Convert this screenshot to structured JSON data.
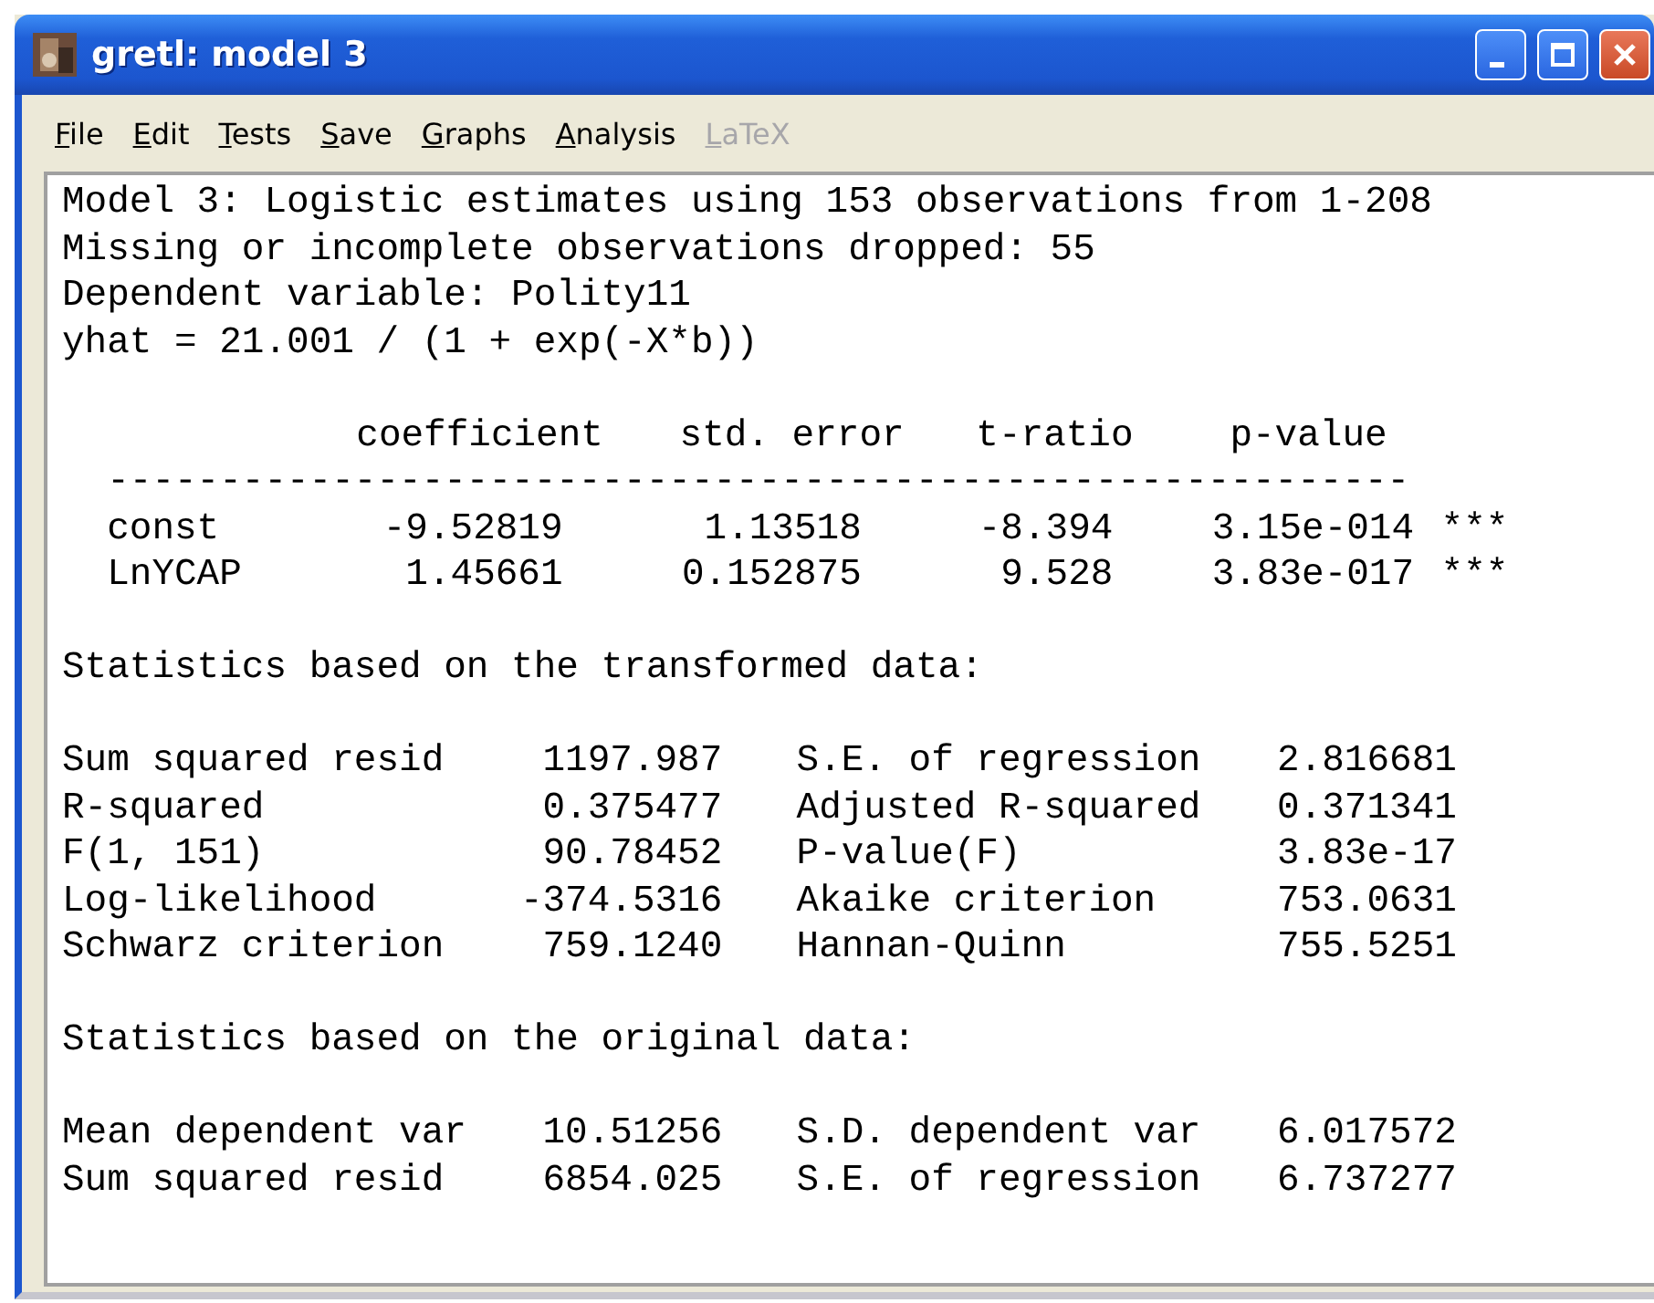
{
  "window": {
    "title": "gretl: model 3"
  },
  "menu": [
    {
      "label": "File",
      "disabled": false
    },
    {
      "label": "Edit",
      "disabled": false
    },
    {
      "label": "Tests",
      "disabled": false
    },
    {
      "label": "Save",
      "disabled": false
    },
    {
      "label": "Graphs",
      "disabled": false
    },
    {
      "label": "Analysis",
      "disabled": false
    },
    {
      "label": "LaTeX",
      "disabled": true
    }
  ],
  "output": {
    "header": [
      "Model 3: Logistic estimates using 153 observations from 1-208",
      "Missing or incomplete observations dropped: 55",
      "Dependent variable: Polity11",
      "yhat = 21.001 / (1 + exp(-X*b))"
    ],
    "table": {
      "columns": [
        "coefficient",
        "std. error",
        "t-ratio",
        "p-value"
      ],
      "separator": "----------------------------------------------------------",
      "rows": [
        {
          "name": "const",
          "coefficient": "-9.52819",
          "std_error": "1.13518",
          "t_ratio": "-8.394",
          "p_value": "3.15e-014",
          "stars": "***"
        },
        {
          "name": "LnYCAP",
          "coefficient": "1.45661",
          "std_error": "0.152875",
          "t_ratio": "9.528",
          "p_value": "3.83e-017",
          "stars": "***"
        }
      ]
    },
    "sections": [
      {
        "title": "Statistics based on the transformed data:",
        "rows": [
          {
            "label": "Sum squared resid",
            "value": "1197.987",
            "label_2": "S.E. of regression",
            "value_2": "2.816681"
          },
          {
            "label": "R-squared",
            "value": "0.375477",
            "label_2": "Adjusted R-squared",
            "value_2": "0.371341"
          },
          {
            "label": "F(1, 151)",
            "value": "90.78452",
            "label_2": "P-value(F)",
            "value_2": "3.83e-17"
          },
          {
            "label": "Log-likelihood",
            "value": "-374.5316",
            "label_2": "Akaike criterion",
            "value_2": "753.0631"
          },
          {
            "label": "Schwarz criterion",
            "value": "759.1240",
            "label_2": "Hannan-Quinn",
            "value_2": "755.5251"
          }
        ]
      },
      {
        "title": "Statistics based on the original data:",
        "rows": [
          {
            "label": "Mean dependent var",
            "value": "10.51256",
            "label_2": "S.D. dependent var",
            "value_2": "6.017572"
          },
          {
            "label": "Sum squared resid",
            "value": "6854.025",
            "label_2": "S.E. of regression",
            "value_2": "6.737277"
          }
        ]
      }
    ]
  }
}
